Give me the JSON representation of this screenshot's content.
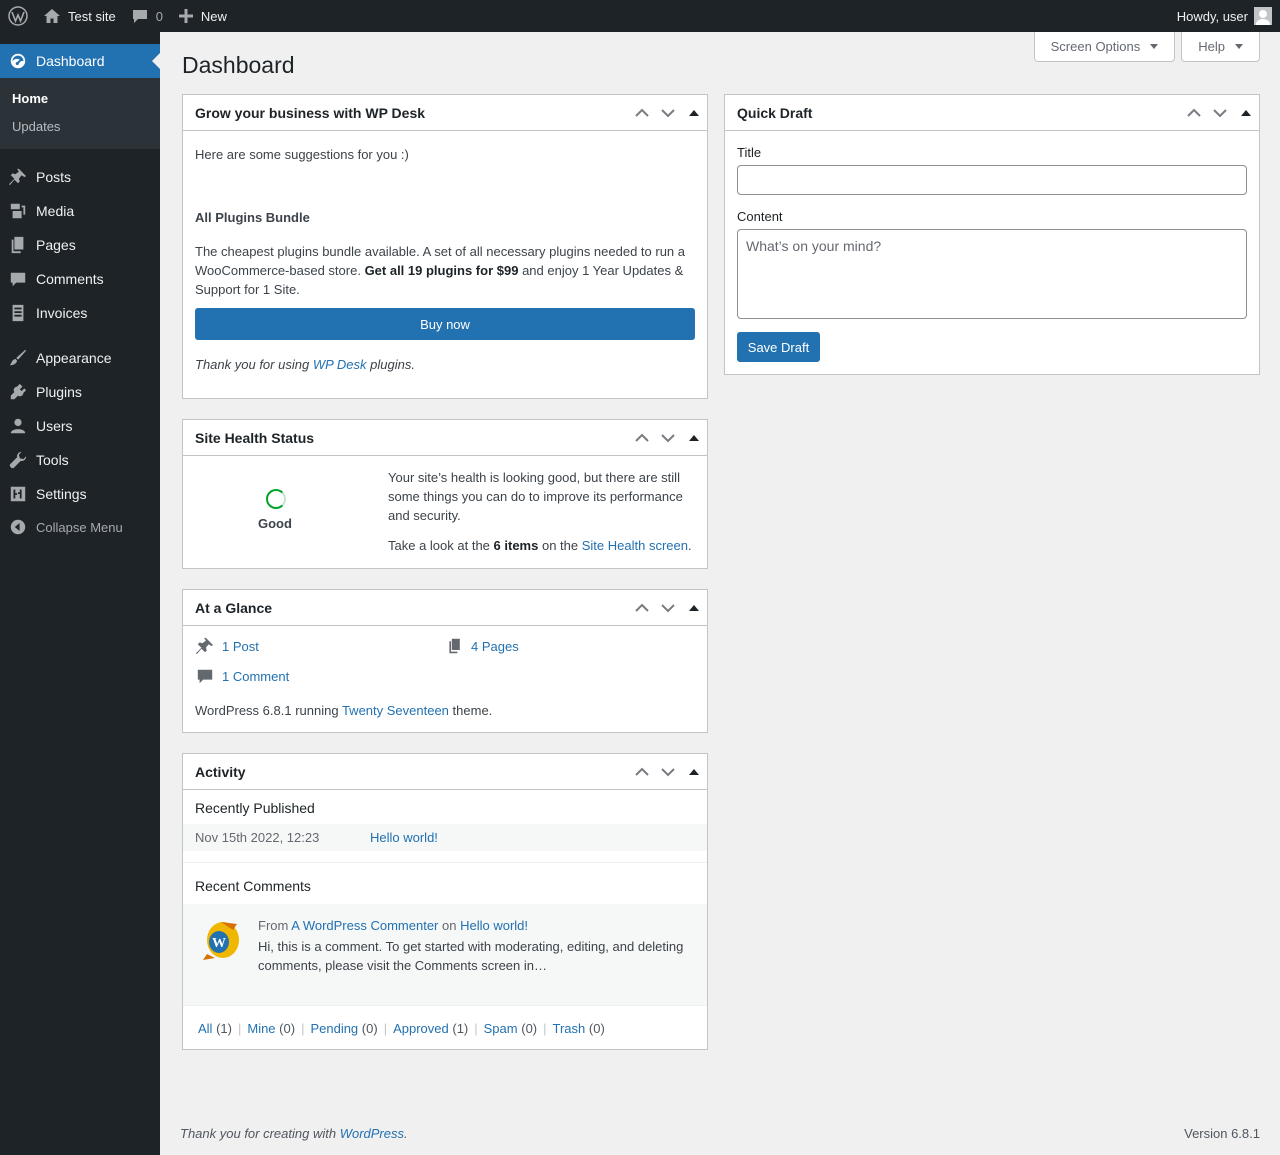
{
  "adminbar": {
    "site_name": "Test site",
    "comments_count": "0",
    "new_label": "New",
    "howdy": "Howdy, user"
  },
  "sidebar": {
    "dashboard": "Dashboard",
    "submenu": [
      "Home",
      "Updates"
    ],
    "items": [
      "Posts",
      "Media",
      "Pages",
      "Comments",
      "Invoices",
      "Appearance",
      "Plugins",
      "Users",
      "Tools",
      "Settings"
    ],
    "collapse": "Collapse Menu"
  },
  "header": {
    "title": "Dashboard",
    "screen_options": "Screen Options",
    "help": "Help"
  },
  "wpdesk": {
    "title": "Grow your business with WP Desk",
    "intro": "Here are some suggestions for you :)",
    "bundle_title": "All Plugins Bundle",
    "desc_1": "The cheapest plugins bundle available. A set of all necessary plugins needed to run a WooCommerce-based store.",
    "desc_bold": "Get all 19 plugins for $99",
    "desc_2": "and enjoy 1 Year Updates & Support for 1 Site.",
    "buy": "Buy now",
    "thanks_1": "Thank you for using",
    "thanks_link": "WP Desk",
    "thanks_2": "plugins."
  },
  "health": {
    "title": "Site Health Status",
    "status": "Good",
    "text": "Your site’s health is looking good, but there are still some things you can do to improve its performance and security.",
    "look_1": "Take a look at the",
    "look_bold": "6 items",
    "look_2": "on the",
    "look_link": "Site Health screen",
    "look_3": "."
  },
  "glance": {
    "title": "At a Glance",
    "posts": "1 Post",
    "pages": "4 Pages",
    "comments": "1 Comment",
    "version_1": "WordPress 6.8.1 running",
    "theme_link": "Twenty Seventeen",
    "version_2": "theme."
  },
  "activity": {
    "title": "Activity",
    "recently_published": "Recently Published",
    "post_date": "Nov 15th 2022, 12:23",
    "post_title": "Hello world!",
    "recent_comments": "Recent Comments",
    "comment_from": "From",
    "comment_author": "A WordPress Commenter",
    "comment_on": "on",
    "comment_post": "Hello world!",
    "comment_text": "Hi, this is a comment. To get started with moderating, editing, and deleting comments, please visit the Comments screen in…",
    "links": [
      {
        "label": "All",
        "count": "(1)"
      },
      {
        "label": "Mine",
        "count": "(0)"
      },
      {
        "label": "Pending",
        "count": "(0)"
      },
      {
        "label": "Approved",
        "count": "(1)"
      },
      {
        "label": "Spam",
        "count": "(0)"
      },
      {
        "label": "Trash",
        "count": "(0)"
      }
    ]
  },
  "quickdraft": {
    "title": "Quick Draft",
    "title_label": "Title",
    "content_label": "Content",
    "content_placeholder": "What’s on your mind?",
    "save": "Save Draft"
  },
  "footer": {
    "thanks_1": "Thank you for creating with",
    "thanks_link": "WordPress",
    "thanks_2": ".",
    "version": "Version 6.8.1"
  }
}
